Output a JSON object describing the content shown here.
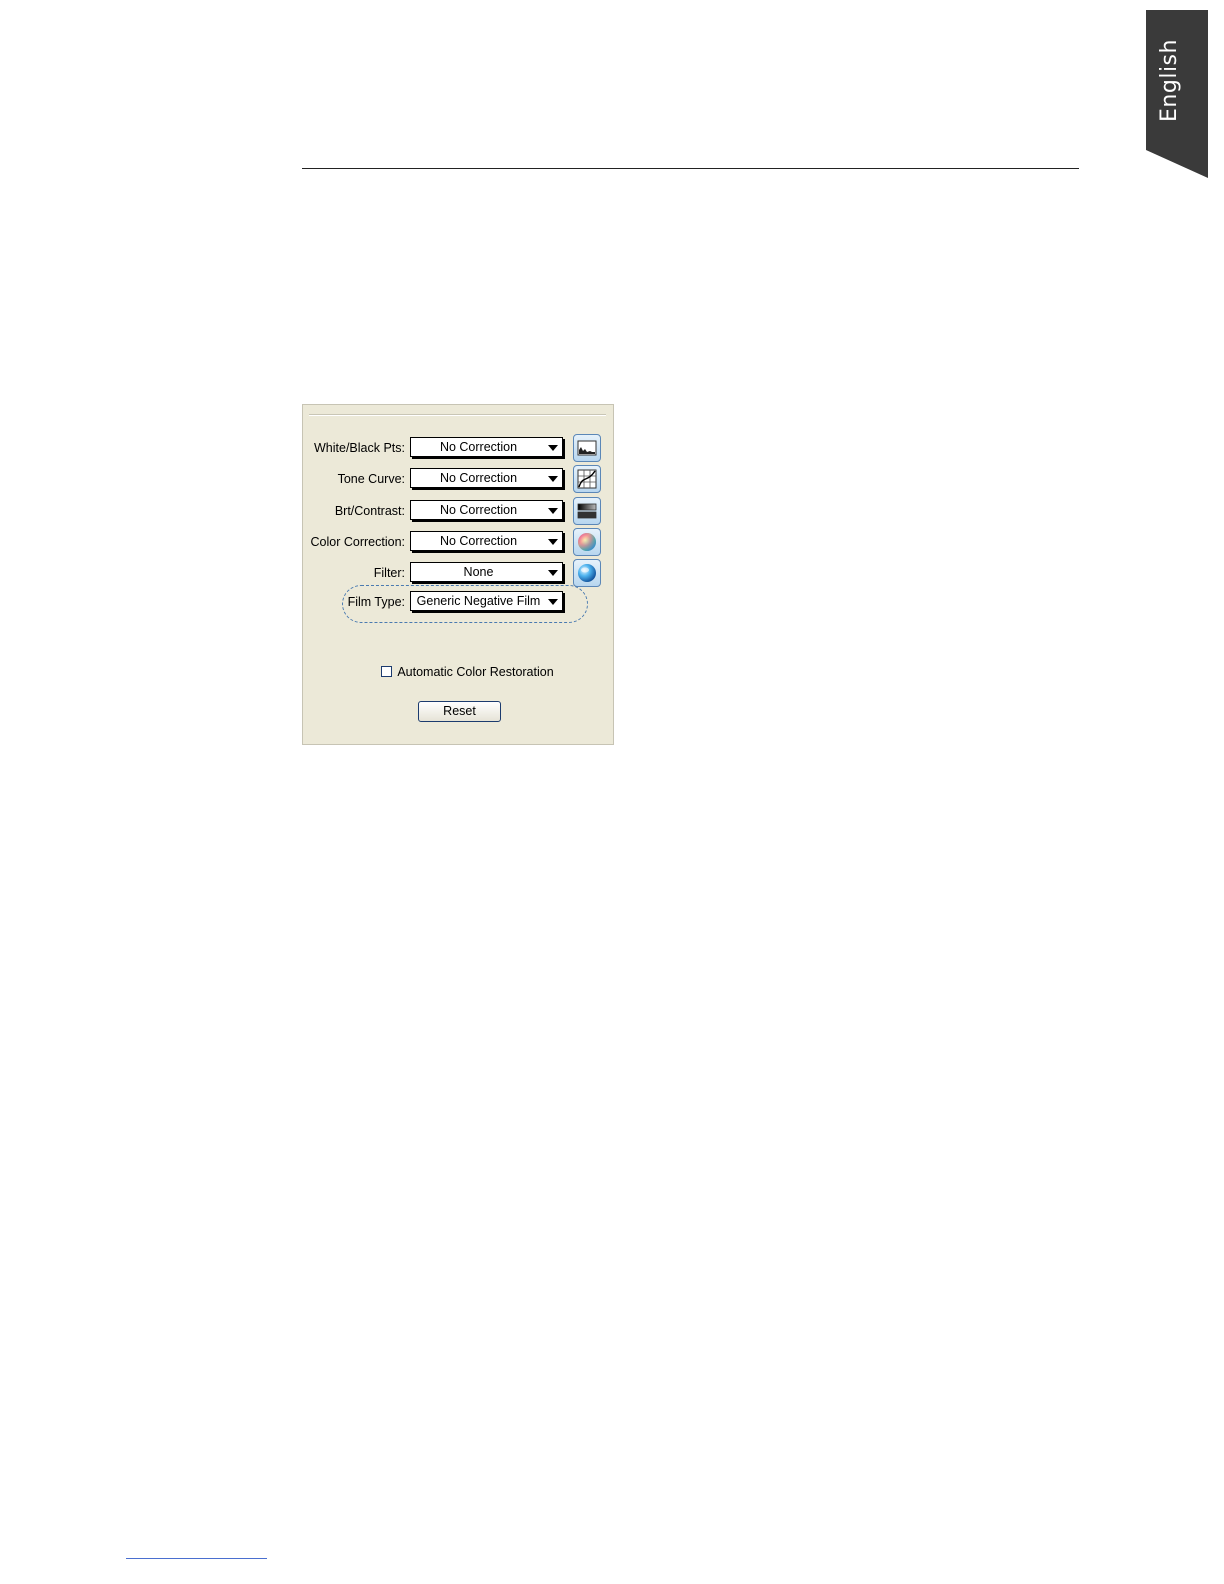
{
  "side_tab": {
    "language": "English"
  },
  "panel": {
    "rows": [
      {
        "label": "White/Black Pts:",
        "value": "No Correction",
        "icon": "histogram-icon"
      },
      {
        "label": "Tone Curve:",
        "value": "No Correction",
        "icon": "tone-curve-icon"
      },
      {
        "label": "Brt/Contrast:",
        "value": "No Correction",
        "icon": "brightness-contrast-icon"
      },
      {
        "label": "Color Correction:",
        "value": "No Correction",
        "icon": "color-wheel-icon"
      },
      {
        "label": "Filter:",
        "value": "None",
        "icon": "filter-sphere-icon"
      }
    ],
    "film_type": {
      "label": "Film Type:",
      "value": "Generic Negative Film"
    },
    "auto_color_restoration": {
      "label": "Automatic Color Restoration",
      "checked": false
    },
    "reset_label": "Reset"
  },
  "colors": {
    "tab": "#3a3a3a",
    "panel_bg": "#ece9d8",
    "accent": "#4a7ab0"
  }
}
